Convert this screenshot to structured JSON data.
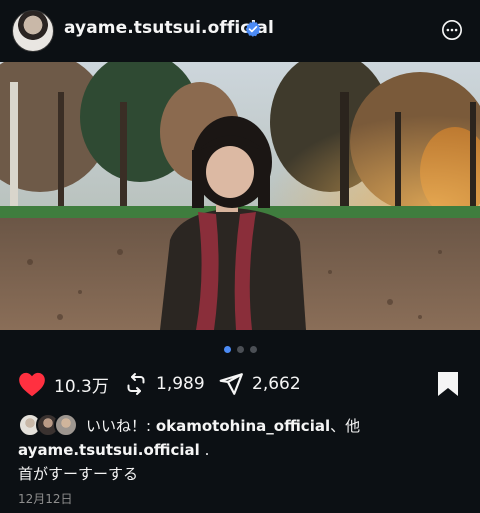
{
  "header": {
    "username": "ayame.tsutsui.official",
    "verified_icon": "verified-badge-icon",
    "more_icon": "more-options-icon"
  },
  "carousel": {
    "count": 3,
    "active_index": 0
  },
  "actions": {
    "likes": "10.3万",
    "reposts": "1,989",
    "shares": "2,662",
    "like_color": "#ff3040"
  },
  "liked_by": {
    "prefix": "いいね！: ",
    "user": "okamotohina_official",
    "suffix": "、他"
  },
  "caption": {
    "username": "ayame.tsutsui.official",
    "trailing": " .",
    "text": "首がすーすーする"
  },
  "date": "12月12日",
  "colors": {
    "background": "#0c1014",
    "accent": "#4c8bf5"
  }
}
